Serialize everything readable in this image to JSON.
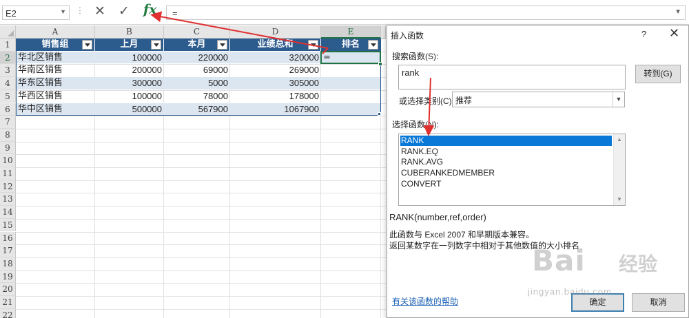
{
  "formula_bar": {
    "name_box": "E2",
    "dots": "⋮",
    "cancel_glyph": "✕",
    "enter_glyph": "✓",
    "fx_label": "fx",
    "formula": "="
  },
  "sheet": {
    "columns": [
      "A",
      "B",
      "C",
      "D",
      "E"
    ],
    "row_numbers": [
      "1",
      "2",
      "3",
      "4",
      "5",
      "6",
      "7",
      "8",
      "9",
      "10",
      "11",
      "12",
      "13",
      "14",
      "15",
      "16",
      "17",
      "18",
      "19",
      "20",
      "21",
      "22"
    ],
    "headers": [
      "销售组",
      "上月",
      "本月",
      "业绩总和",
      "排名"
    ],
    "rows": [
      [
        "华北区销售",
        "100000",
        "220000",
        "320000",
        "="
      ],
      [
        "华南区销售",
        "200000",
        "69000",
        "269000",
        ""
      ],
      [
        "华东区销售",
        "300000",
        "5000",
        "305000",
        ""
      ],
      [
        "华西区销售",
        "100000",
        "78000",
        "178000",
        ""
      ],
      [
        "华中区销售",
        "500000",
        "567900",
        "1067900",
        ""
      ]
    ],
    "selected_cell": "E2",
    "colors": {
      "header_fill": "#2c5b8d",
      "band_fill": "#dce6f1",
      "selection": "#217346"
    }
  },
  "dialog": {
    "title": "插入函数",
    "help_glyph": "?",
    "close_glyph": "✕",
    "search_label": "搜索函数(S):",
    "search_value": "rank",
    "go_button": "转到(G)",
    "category_label": "或选择类别(C):",
    "category_value": "推荐",
    "function_list_label": "选择函数(N):",
    "functions": [
      "RANK",
      "RANK.EQ",
      "RANK.AVG",
      "CUBERANKEDMEMBER",
      "CONVERT"
    ],
    "selected_function": "RANK",
    "signature": "RANK(number,ref,order)",
    "description_1": "此函数与 Excel 2007 和早期版本兼容。",
    "description_2": "返回某数字在一列数字中相对于其他数值的大小排名",
    "help_link": "有关该函数的帮助",
    "ok_button": "确定",
    "cancel_button": "取消",
    "colors": {
      "selected_item": "#0a78d7",
      "link": "#1a5fb4"
    }
  },
  "watermark": {
    "brand": "Bai",
    "brand_cn": "经验",
    "url": "jingyan.baidu.com"
  },
  "annotation_color": "#e03030"
}
